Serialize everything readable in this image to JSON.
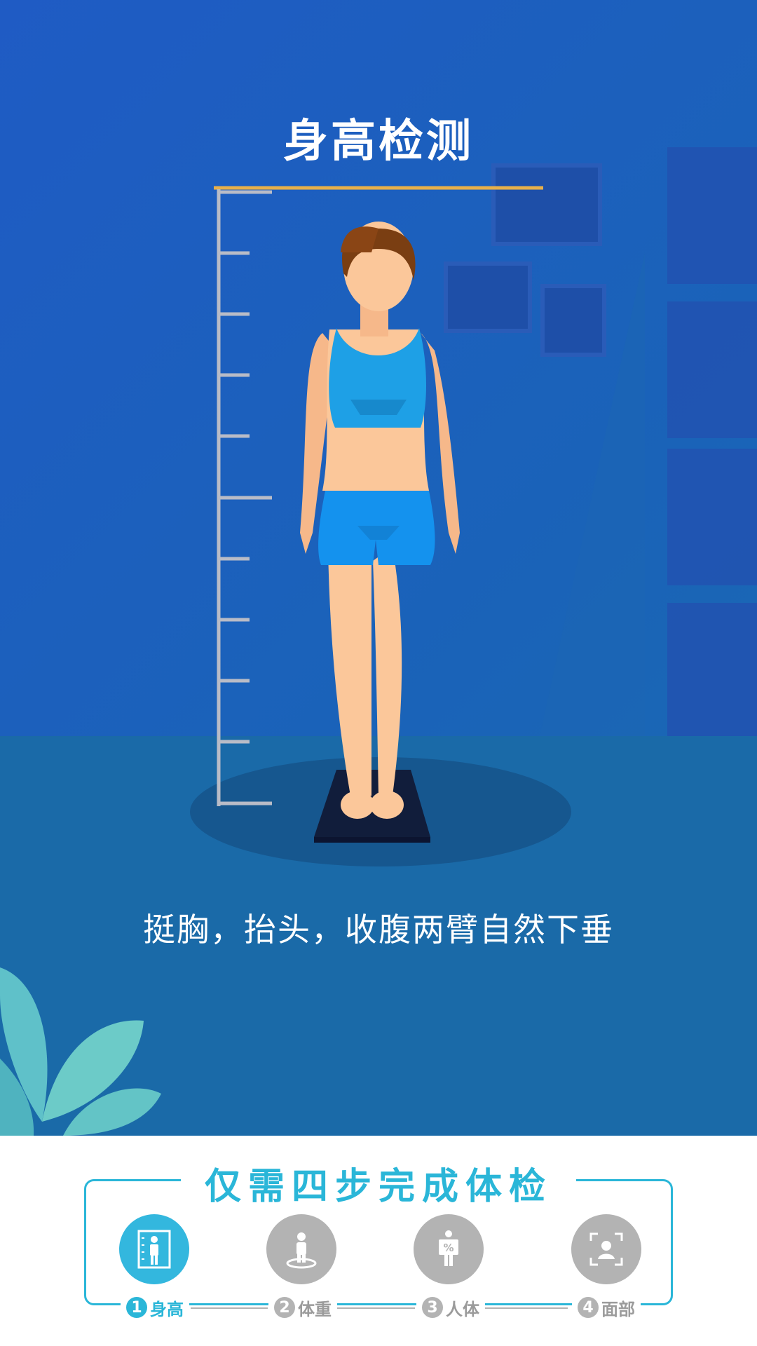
{
  "scene": {
    "title": "身高检测",
    "instruction": "挺胸，抬头，收腹两臂自然下垂"
  },
  "steps": {
    "heading": "仅需四步完成体检",
    "items": [
      {
        "number": "1",
        "label": "身高",
        "icon": "height-measure-icon",
        "active": true
      },
      {
        "number": "2",
        "label": "体重",
        "icon": "weight-scale-icon",
        "active": false
      },
      {
        "number": "3",
        "label": "人体",
        "icon": "body-composition-icon",
        "active": false
      },
      {
        "number": "4",
        "label": "面部",
        "icon": "face-scan-icon",
        "active": false
      }
    ]
  },
  "colors": {
    "accent": "#2ab6d8",
    "background": "#1f5bc4",
    "inactive": "#b3b3b3"
  }
}
